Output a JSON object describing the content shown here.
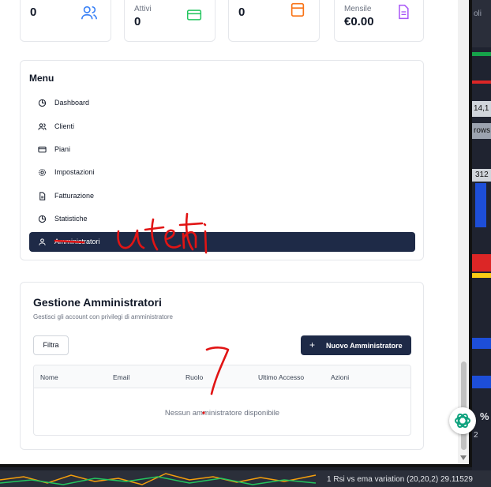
{
  "stats": [
    {
      "label": "",
      "value": "0",
      "icon": "users-icon"
    },
    {
      "label": "Attivi",
      "value": "0",
      "icon": "credit-card-icon"
    },
    {
      "label": "",
      "value": "0",
      "icon": "calendar-icon"
    },
    {
      "label": "Mensile",
      "value": "€0.00",
      "icon": "document-icon"
    }
  ],
  "menu": {
    "title": "Menu",
    "items": [
      {
        "label": "Dashboard",
        "icon": "pie-chart-icon"
      },
      {
        "label": "Clienti",
        "icon": "users-icon"
      },
      {
        "label": "Piani",
        "icon": "credit-card-icon"
      },
      {
        "label": "Impostazioni",
        "icon": "gear-icon"
      },
      {
        "label": "Fatturazione",
        "icon": "document-icon"
      },
      {
        "label": "Statistiche",
        "icon": "pie-chart-icon"
      },
      {
        "label": "Amministratori",
        "icon": "user-icon",
        "active": true
      }
    ]
  },
  "admins": {
    "title": "Gestione Amministratori",
    "subtitle": "Gestisci gli account con privilegi di amministratore",
    "filter_label": "Filtra",
    "new_label": "Nuovo Amministratore",
    "columns": [
      "Nome",
      "Email",
      "Ruolo",
      "Ultimo Accesso",
      "Azioni"
    ],
    "empty_message": "Nessun amministratore disponibile"
  },
  "annotations": {
    "word": "utenti",
    "number": "7",
    "color": "#e11414"
  },
  "background_app": {
    "texts": [
      "oli",
      "14,1",
      "rows",
      "312",
      "2",
      "%"
    ],
    "footer_text": "1 Rsi vs ema variation (20,20,2) 29.11529"
  },
  "colors": {
    "accent": "#1e2a47",
    "stat_icon_users": "#3b82f6",
    "stat_icon_card": "#22c55e",
    "stat_icon_calendar": "#f97316",
    "stat_icon_document": "#a855f7"
  }
}
